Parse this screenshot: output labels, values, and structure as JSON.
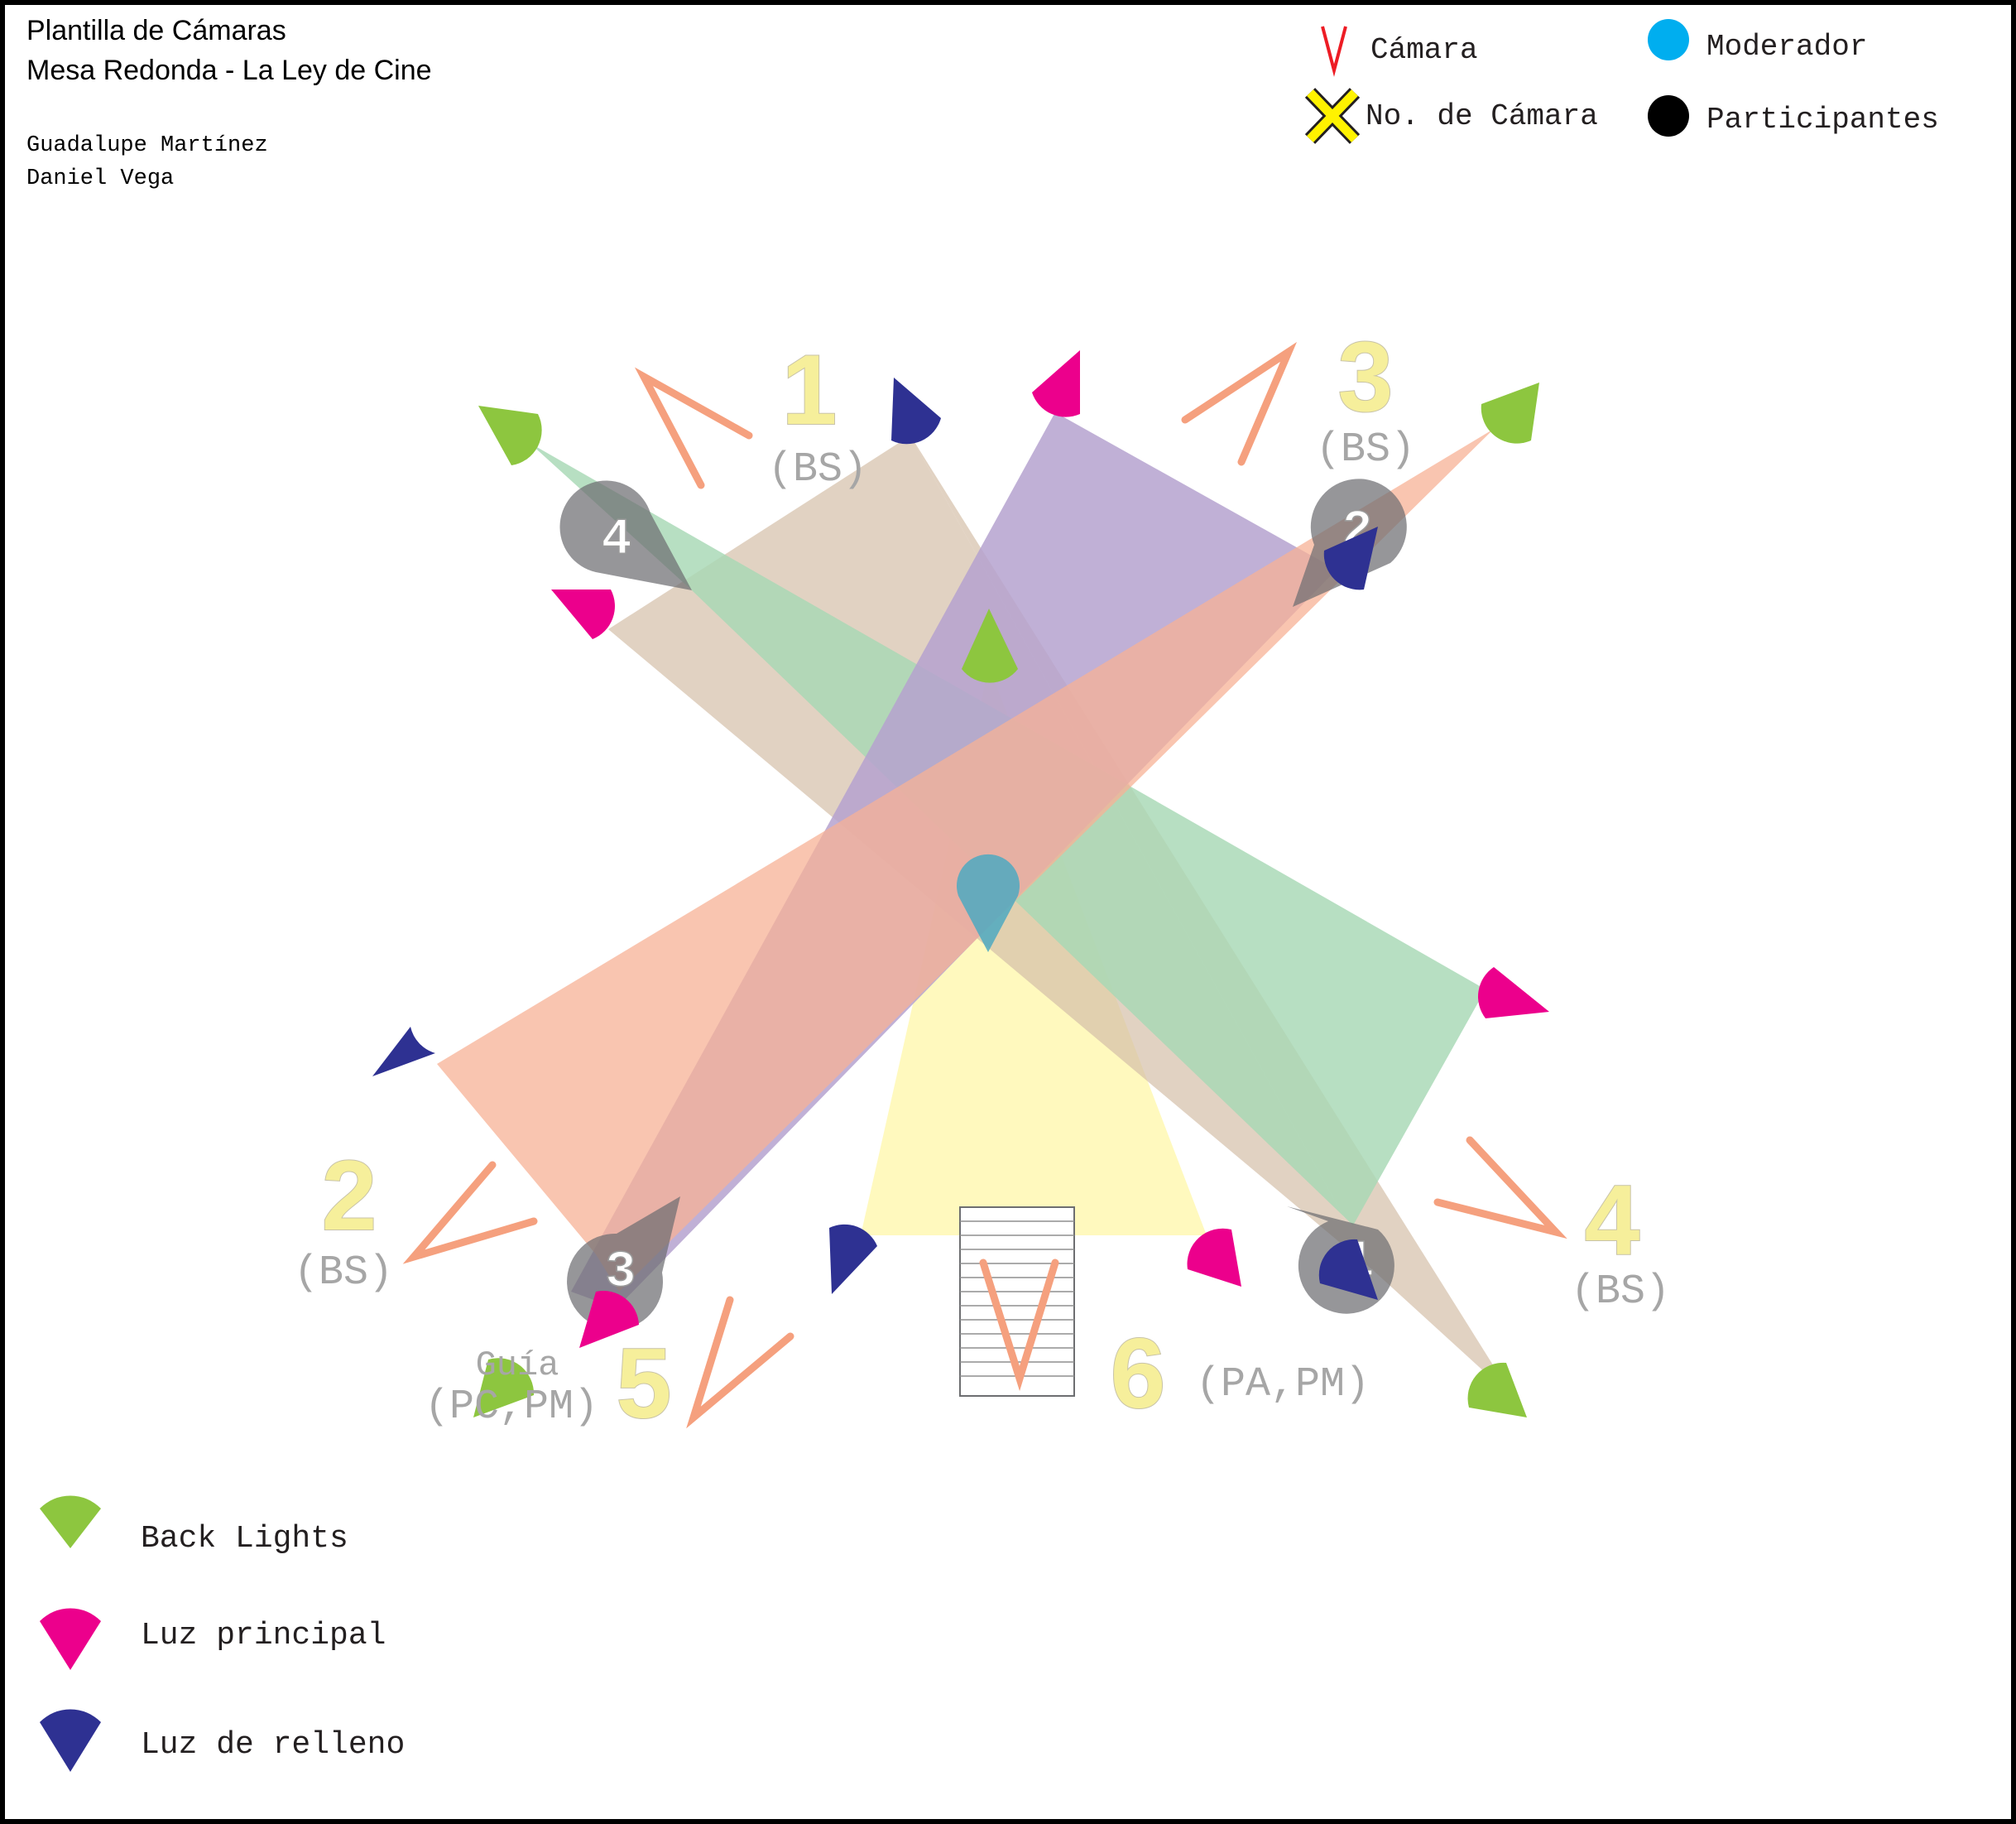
{
  "header": {
    "title_line1": "Plantilla de Cámaras",
    "title_line2": "Mesa Redonda - La Ley de Cine",
    "author1": "Guadalupe Martínez",
    "author2": "Daniel Vega"
  },
  "key": {
    "camera": "Cámara",
    "camera_number": "No. de Cámara",
    "moderator": "Moderador",
    "participants": "Participantes"
  },
  "lights_legend": [
    {
      "label": "Back Lights",
      "color": "#8dc63f",
      "icon": "back-light-icon"
    },
    {
      "label": "Luz principal",
      "color": "#ec008c",
      "icon": "key-light-icon"
    },
    {
      "label": "Luz de relleno",
      "color": "#2e3192",
      "icon": "fill-light-icon"
    }
  ],
  "cameras": [
    {
      "number": "1",
      "shot": "(BS)"
    },
    {
      "number": "2",
      "shot": "(BS)"
    },
    {
      "number": "3",
      "shot": "(BS)"
    },
    {
      "number": "4",
      "shot": "(BS)"
    },
    {
      "number": "5",
      "shot": "(PC,PM)",
      "note": "Guía"
    },
    {
      "number": "6",
      "shot": "(PA,PM)"
    }
  ],
  "participant_tags": [
    "4",
    "2",
    "3",
    "1"
  ],
  "colors": {
    "camera": "#f5a07e",
    "camera_number_fill": "#f6ef9b",
    "moderator": "#00aeef",
    "participant": "#000000",
    "participant_marker": "#6d6e71",
    "back_light": "#8dc63f",
    "key_light": "#ec008c",
    "fill_light": "#2e3192"
  }
}
